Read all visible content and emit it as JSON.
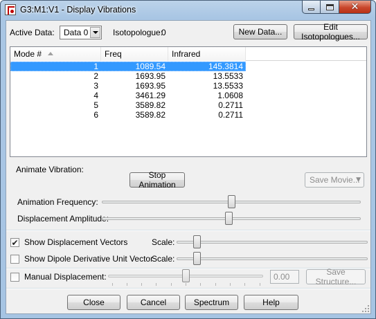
{
  "window": {
    "title": "G3:M1:V1 - Display Vibrations",
    "icon": "gaussview-app-icon",
    "close_glyph": "✕"
  },
  "top": {
    "active_data_label": "Active Data:",
    "active_data_value": "Data 0",
    "isotopologue_label": "Isotopologue:",
    "isotopologue_value": "0",
    "new_data_button": "New Data...",
    "edit_isotopologues_button": "Edit Isotopologues..."
  },
  "table": {
    "columns": [
      "Mode #",
      "Freq",
      "Infrared"
    ],
    "rows": [
      {
        "mode": "1",
        "freq": "1089.54",
        "ir": "145.3814",
        "selected": true
      },
      {
        "mode": "2",
        "freq": "1693.95",
        "ir": "13.5533",
        "selected": false
      },
      {
        "mode": "3",
        "freq": "1693.95",
        "ir": "13.5533",
        "selected": false
      },
      {
        "mode": "4",
        "freq": "3461.29",
        "ir": "1.0608",
        "selected": false
      },
      {
        "mode": "5",
        "freq": "3589.82",
        "ir": "0.2711",
        "selected": false
      },
      {
        "mode": "6",
        "freq": "3589.82",
        "ir": "0.2711",
        "selected": false
      }
    ]
  },
  "animate": {
    "group_label": "Animate Vibration:",
    "stop_button": "Stop Animation",
    "save_movie_button": "Save Movie...",
    "frequency_label": "Animation Frequency:",
    "frequency_level": 0.5,
    "amplitude_label": "Displacement Amplitude:",
    "amplitude_level": 0.49
  },
  "options": {
    "show_vectors_label": "Show Displacement Vectors",
    "show_vectors_checked": true,
    "show_vectors_scale_label": "Scale:",
    "show_vectors_scale_level": 0.09,
    "dipole_label": "Show Dipole Derivative Unit Vector",
    "dipole_checked": false,
    "dipole_scale_label": "Scale:",
    "dipole_scale_level": 0.09,
    "manual_label": "Manual Displacement:",
    "manual_checked": false,
    "manual_level": 0.5,
    "manual_value": "0.00",
    "save_structure_button": "Save Structure..."
  },
  "footer": {
    "close_button": "Close",
    "cancel_button": "Cancel",
    "spectrum_button": "Spectrum",
    "help_button": "Help"
  },
  "colors": {
    "selection": "#3399ff",
    "titlebar": "#bcd3ea",
    "close_button": "#c9462c"
  }
}
